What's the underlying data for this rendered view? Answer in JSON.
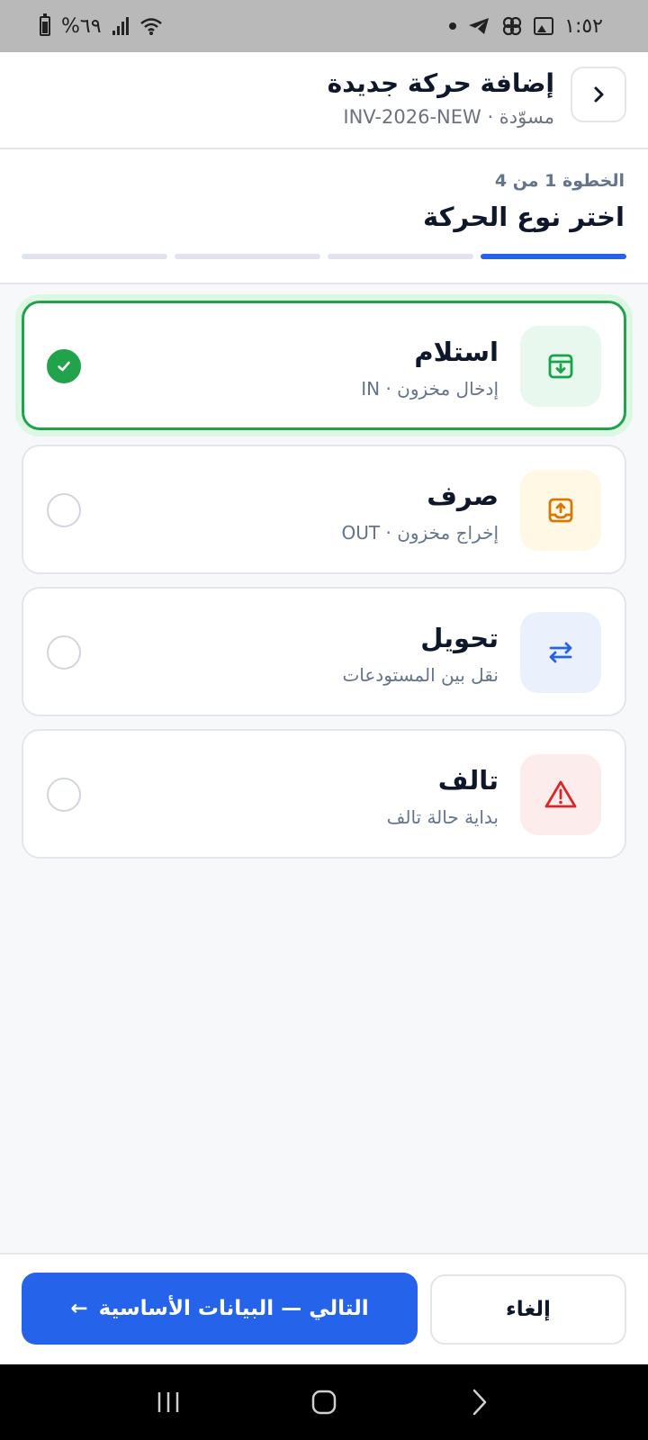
{
  "status_bar": {
    "time": "١:٥٢",
    "battery": "%٦٩"
  },
  "header": {
    "title": "إضافة حركة جديدة",
    "subtitle": "مسوّدة · INV-2026-NEW",
    "back_icon": "chevron-right-icon"
  },
  "step": {
    "counter": "الخطوة 1 من 4",
    "title": "اختر نوع الحركة",
    "total": 4,
    "current": 1
  },
  "options": [
    {
      "title": "استلام",
      "subtitle": "إدخال مخزون · IN",
      "icon": "archive-down-icon",
      "selected": true,
      "tile_color": "#e8f8ee",
      "icon_color": "#16a34a"
    },
    {
      "title": "صرف",
      "subtitle": "إخراج مخزون · OUT",
      "icon": "tray-up-icon",
      "selected": false,
      "tile_color": "#fef8e4",
      "icon_color": "#d97706"
    },
    {
      "title": "تحويل",
      "subtitle": "نقل بين المستودعات",
      "icon": "swap-arrows-icon",
      "selected": false,
      "tile_color": "#eaf1fd",
      "icon_color": "#2563eb"
    },
    {
      "title": "تالف",
      "subtitle": "بداية حالة تالف",
      "icon": "warning-triangle-icon",
      "selected": false,
      "tile_color": "#fdecec",
      "icon_color": "#dc2626"
    }
  ],
  "footer": {
    "cancel_label": "إلغاء",
    "next_label": "التالي — البيانات الأساسية",
    "next_arrow": "←"
  }
}
